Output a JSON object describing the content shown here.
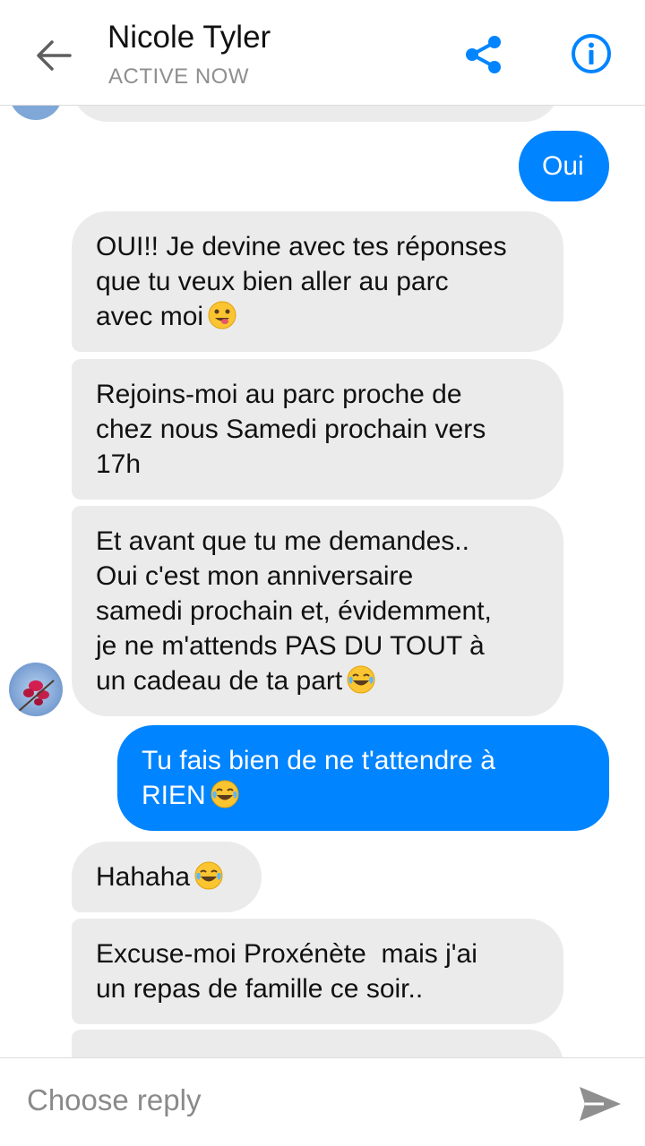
{
  "header": {
    "contact_name": "Nicole Tyler",
    "status": "ACTIVE NOW",
    "back_icon": "back-arrow-icon",
    "share_icon": "share-icon",
    "info_icon": "info-icon",
    "accent_color": "#0084ff"
  },
  "messages": [
    {
      "sender": "them",
      "text": ""
    },
    {
      "sender": "me",
      "text": "Oui"
    },
    {
      "sender": "them",
      "text": "OUI!! Je devine avec tes réponses\nque tu veux bien aller au parc\navec moi",
      "emoji": "tongue-wink-emoji"
    },
    {
      "sender": "them",
      "text": "Rejoins-moi au parc proche de\nchez nous Samedi prochain vers\n17h"
    },
    {
      "sender": "them",
      "text": "Et avant que tu me demandes..\nOui c'est mon anniversaire\nsamedi prochain et, évidemment,\nje ne m'attends PAS DU TOUT à\nun cadeau de ta part",
      "emoji": "tears-of-joy-emoji"
    },
    {
      "sender": "me",
      "text": "Tu fais bien de ne t'attendre à\nRIEN",
      "emoji": "tears-of-joy-emoji"
    },
    {
      "sender": "them",
      "text": "Hahaha",
      "emoji": "tears-of-joy-emoji"
    },
    {
      "sender": "them",
      "text": "Excuse-moi Proxénète  mais j'ai\nun repas de famille ce soir.."
    },
    {
      "sender": "them",
      "text": ""
    }
  ],
  "footer": {
    "reply_placeholder": "Choose reply",
    "send_icon": "send-icon"
  }
}
